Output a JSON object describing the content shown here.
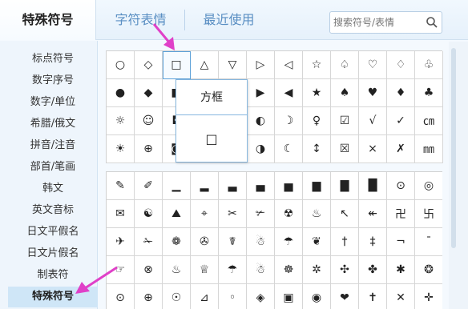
{
  "tabs": [
    {
      "label": "特殊符号",
      "active": true
    },
    {
      "label": "字符表情",
      "active": false
    },
    {
      "label": "最近使用",
      "active": false
    }
  ],
  "search": {
    "placeholder": "搜索符号/表情"
  },
  "sidebar": {
    "items": [
      {
        "label": "标点符号"
      },
      {
        "label": "数字序号"
      },
      {
        "label": "数字/单位"
      },
      {
        "label": "希腊/俄文"
      },
      {
        "label": "拼音/注音"
      },
      {
        "label": "部首/笔画"
      },
      {
        "label": "韩文"
      },
      {
        "label": "英文音标"
      },
      {
        "label": "日文平假名"
      },
      {
        "label": "日文片假名"
      },
      {
        "label": "制表符"
      },
      {
        "label": "特殊符号",
        "active": true
      }
    ]
  },
  "grid1": {
    "rows": [
      [
        "○",
        "◇",
        "□",
        "△",
        "▽",
        "▷",
        "◁",
        "☆",
        "♤",
        "♡",
        "♢",
        "♧"
      ],
      [
        "●",
        "◆",
        "■",
        "▲",
        "▼",
        "▶",
        "◀",
        "★",
        "♠",
        "♥",
        "♦",
        "♣"
      ],
      [
        "☼",
        "☺",
        "◘",
        "♀",
        "☻",
        "◐",
        "☽",
        "♀",
        "☑",
        "√",
        "✓",
        "㎝"
      ],
      [
        "☀",
        "⊕",
        "◙",
        "♂",
        "☾",
        "◑",
        "☾",
        "↕",
        "☒",
        "×",
        "✗",
        "㎜"
      ]
    ]
  },
  "popup": {
    "name": "方框",
    "symbol": "□"
  },
  "grid2": {
    "rows": [
      [
        "✎",
        "✐",
        "▁",
        "▂",
        "▃",
        "▄",
        "▅",
        "▆",
        "▇",
        "█",
        "⊙",
        "◎"
      ],
      [
        "✉",
        "☯",
        "⛰",
        "⌖",
        "✂",
        "✃",
        "☢",
        "♨",
        "↖",
        "↞",
        "卍",
        "卐"
      ],
      [
        "✈",
        "✁",
        "❁",
        "✇",
        "☤",
        "☃",
        "☂",
        "❦",
        "†",
        "‡",
        "¬",
        "¯"
      ],
      [
        "☞",
        "⊗",
        "♨",
        "♕",
        "☂",
        "☃",
        "☸",
        "✲",
        "✣",
        "✤",
        "✱",
        "❂"
      ],
      [
        "⊙",
        "⊕",
        "☉",
        "⊿",
        "◦",
        "◈",
        "▣",
        "◉",
        "❤",
        "✝",
        "✕",
        "✛"
      ]
    ]
  }
}
